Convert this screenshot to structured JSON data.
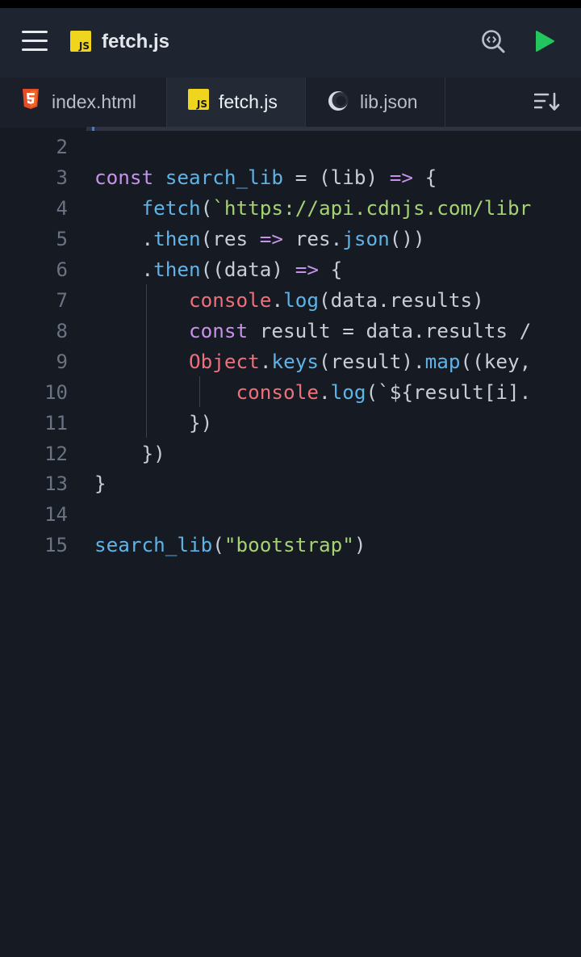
{
  "header": {
    "title": "fetch.js",
    "file_icon": "js-file-icon",
    "menu_icon": "hamburger-menu-icon",
    "find_icon": "code-search-icon",
    "run_icon": "play-icon"
  },
  "tabs": [
    {
      "label": "index.html",
      "icon": "html5-icon",
      "active": false
    },
    {
      "label": "fetch.js",
      "icon": "js-file-icon",
      "active": true
    },
    {
      "label": "lib.json",
      "icon": "json-moon-icon",
      "active": false
    }
  ],
  "tab_menu_icon": "sort-descending-icon",
  "editor": {
    "lines": [
      {
        "num": "2",
        "text": ""
      },
      {
        "num": "3",
        "text": "const search_lib = (lib) => {"
      },
      {
        "num": "4",
        "text": "    fetch(`https://api.cdnjs.com/libr"
      },
      {
        "num": "5",
        "text": "    .then(res => res.json())"
      },
      {
        "num": "6",
        "text": "    .then((data) => {"
      },
      {
        "num": "7",
        "text": "        console.log(data.results)"
      },
      {
        "num": "8",
        "text": "        const result = data.results /"
      },
      {
        "num": "9",
        "text": "        Object.keys(result).map((key,"
      },
      {
        "num": "10",
        "text": "            console.log(`${result[i]."
      },
      {
        "num": "11",
        "text": "        })"
      },
      {
        "num": "12",
        "text": "    })"
      },
      {
        "num": "13",
        "text": "}"
      },
      {
        "num": "14",
        "text": ""
      },
      {
        "num": "15",
        "text": "search_lib(\"bootstrap\")"
      }
    ]
  },
  "colors": {
    "background": "#151a23",
    "header": "#1f2530",
    "keyword": "#c792ea",
    "function": "#5fb3e6",
    "string": "#a6d273",
    "object": "#ef6f7a",
    "text": "#c7ced8",
    "line_number": "#6a7382",
    "run_button": "#22c55e",
    "js_badge": "#f0d51f",
    "html5": "#e44d26"
  }
}
